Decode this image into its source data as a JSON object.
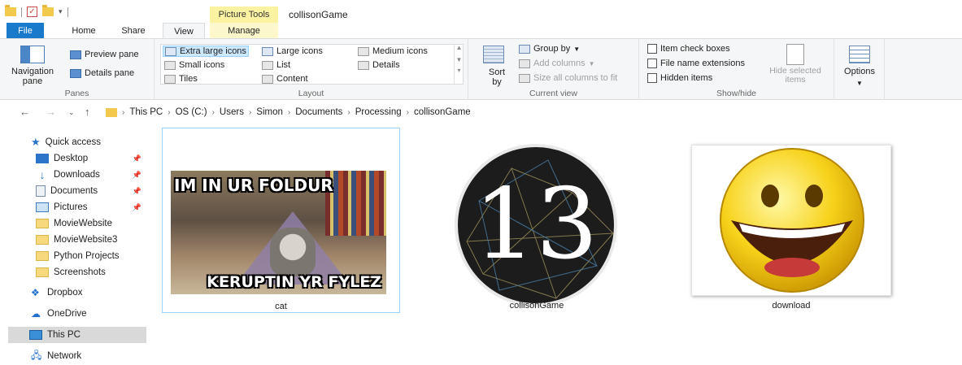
{
  "window": {
    "title": "collisonGame",
    "context_tab_group": "Picture Tools"
  },
  "tabs": {
    "file": "File",
    "home": "Home",
    "share": "Share",
    "view": "View",
    "manage": "Manage"
  },
  "ribbon": {
    "panes": {
      "navigation_pane": "Navigation pane",
      "preview_pane": "Preview pane",
      "details_pane": "Details pane",
      "label": "Panes"
    },
    "layout": {
      "extra_large_icons": "Extra large icons",
      "large_icons": "Large icons",
      "medium_icons": "Medium icons",
      "small_icons": "Small icons",
      "list": "List",
      "details": "Details",
      "tiles": "Tiles",
      "content": "Content",
      "label": "Layout"
    },
    "current_view": {
      "sort_by": "Sort by",
      "group_by": "Group by",
      "add_columns": "Add columns",
      "size_all_columns": "Size all columns to fit",
      "label": "Current view"
    },
    "show_hide": {
      "item_check_boxes": "Item check boxes",
      "file_name_extensions": "File name extensions",
      "hidden_items": "Hidden items",
      "hide_selected_items": "Hide selected items",
      "label": "Show/hide"
    },
    "options": "Options"
  },
  "address": {
    "crumbs": [
      "This PC",
      "OS (C:)",
      "Users",
      "Simon",
      "Documents",
      "Processing",
      "collisonGame"
    ]
  },
  "nav": {
    "quick_access": "Quick access",
    "items": [
      {
        "label": "Desktop",
        "icon": "desktop-icon",
        "pinned": true
      },
      {
        "label": "Downloads",
        "icon": "download-arrow-icon",
        "pinned": true
      },
      {
        "label": "Documents",
        "icon": "documents-icon",
        "pinned": true
      },
      {
        "label": "Pictures",
        "icon": "pictures-icon",
        "pinned": true
      },
      {
        "label": "MovieWebsite",
        "icon": "folder-icon",
        "pinned": false
      },
      {
        "label": "MovieWebsite3",
        "icon": "folder-icon",
        "pinned": false
      },
      {
        "label": "Python Projects",
        "icon": "folder-icon",
        "pinned": false
      },
      {
        "label": "Screenshots",
        "icon": "folder-icon",
        "pinned": false
      }
    ],
    "dropbox": "Dropbox",
    "onedrive": "OneDrive",
    "this_pc": "This PC",
    "network": "Network"
  },
  "files": [
    {
      "name": "cat",
      "meme_top": "IM IN UR FOLDUR",
      "meme_bottom": "KERUPTIN YR FYLEZ",
      "selected": true
    },
    {
      "name": "collisonGame",
      "logo_text": "13",
      "selected": false
    },
    {
      "name": "download",
      "selected": false
    }
  ],
  "colors": {
    "file_tab": "#1979ca",
    "picture_tools": "#fbf2a2",
    "selection": "#cce8ff"
  }
}
